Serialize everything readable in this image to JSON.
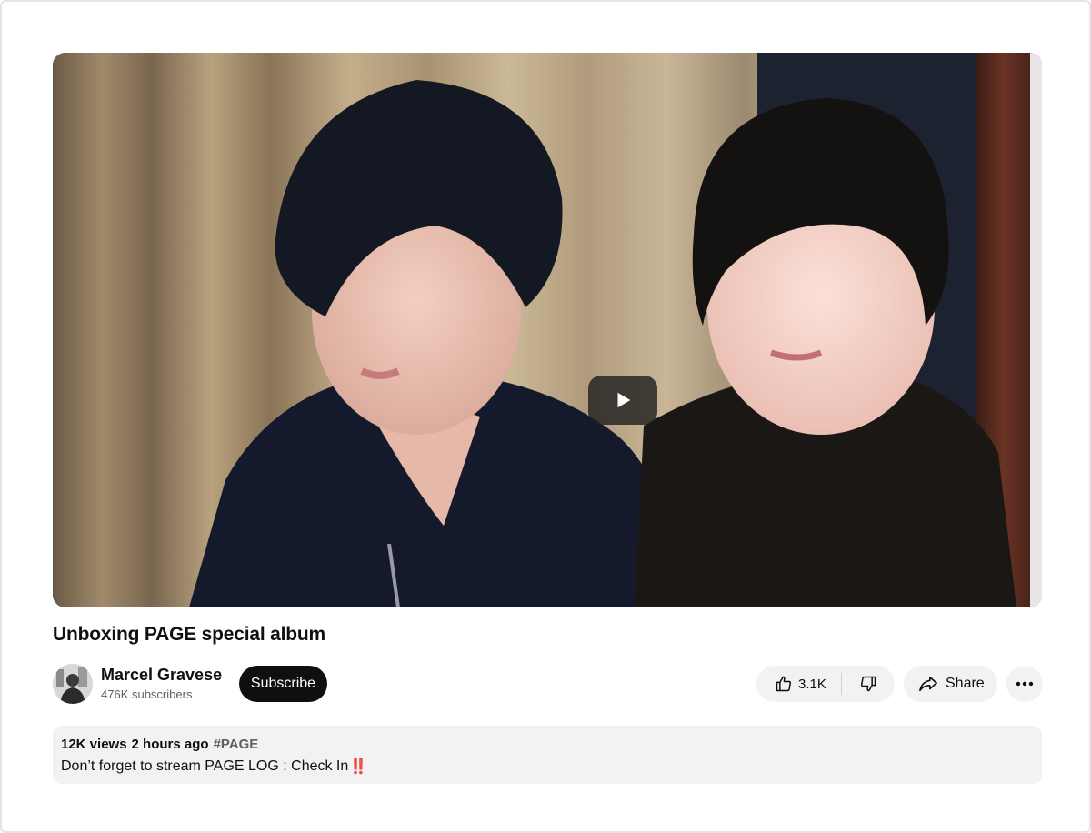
{
  "video": {
    "title": "Unboxing PAGE special album",
    "play_icon": "play-icon"
  },
  "channel": {
    "name": "Marcel Gravese",
    "subscribers": "476K subscribers",
    "subscribe_label": "Subscribe"
  },
  "actions": {
    "like_count": "3.1K",
    "like_icon": "thumbs-up-icon",
    "dislike_icon": "thumbs-down-icon",
    "share_label": "Share",
    "share_icon": "share-arrow-icon",
    "more_icon": "more-horizontal-icon"
  },
  "description": {
    "views": "12K views",
    "time_ago": "2 hours ago",
    "hashtag": "#PAGE",
    "text": "Don’t forget to stream PAGE LOG : Check In",
    "emoji": "‼️"
  },
  "colors": {
    "subscribe_bg": "#0f0f0f",
    "pill_bg": "#f2f2f2",
    "emoji_red": "#e0201b"
  }
}
